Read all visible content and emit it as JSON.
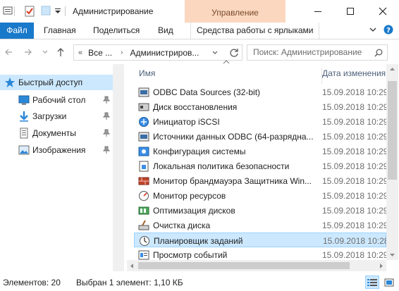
{
  "window": {
    "title": "Администрирование",
    "context_tab": "Управление"
  },
  "ribbon": {
    "tabs": [
      "Файл",
      "Главная",
      "Поделиться",
      "Вид",
      "Средства работы с ярлыками"
    ]
  },
  "address": {
    "segments": [
      "Все ...",
      "Администриров..."
    ],
    "search_placeholder": "Поиск: Администрирование"
  },
  "nav": {
    "items": [
      {
        "label": "Быстрый доступ",
        "icon": "star-icon",
        "selected": true
      },
      {
        "label": "Рабочий стол",
        "icon": "desktop-icon",
        "pinned": true
      },
      {
        "label": "Загрузки",
        "icon": "download-icon",
        "pinned": true
      },
      {
        "label": "Документы",
        "icon": "documents-icon",
        "pinned": true
      },
      {
        "label": "Изображения",
        "icon": "pictures-icon",
        "pinned": true
      }
    ]
  },
  "list": {
    "col_name": "Имя",
    "col_date": "Дата изменения",
    "rows": [
      {
        "name": "ODBC Data Sources (32-bit)",
        "date": "15.09.2018 10:29",
        "icon": "odbc-icon"
      },
      {
        "name": "Диск восстановления",
        "date": "15.09.2018 10:29",
        "icon": "recovery-icon"
      },
      {
        "name": "Инициатор iSCSI",
        "date": "15.09.2018 10:29",
        "icon": "iscsi-icon"
      },
      {
        "name": "Источники данных ODBC (64-разрядна...",
        "date": "15.09.2018 10:29",
        "icon": "odbc-icon"
      },
      {
        "name": "Конфигурация системы",
        "date": "15.09.2018 10:29",
        "icon": "msconfig-icon"
      },
      {
        "name": "Локальная политика безопасности",
        "date": "15.09.2018 10:29",
        "icon": "security-policy-icon"
      },
      {
        "name": "Монитор брандмауэра Защитника Win...",
        "date": "15.09.2018 10:29",
        "icon": "firewall-icon"
      },
      {
        "name": "Монитор ресурсов",
        "date": "15.09.2018 10:29",
        "icon": "resmon-icon"
      },
      {
        "name": "Оптимизация дисков",
        "date": "15.09.2018 10:29",
        "icon": "defrag-icon"
      },
      {
        "name": "Очистка диска",
        "date": "15.09.2018 10:29",
        "icon": "cleanup-icon"
      },
      {
        "name": "Планировщик заданий",
        "date": "15.09.2018 10:28",
        "icon": "task-scheduler-icon",
        "selected": true
      },
      {
        "name": "Просмотр событий",
        "date": "15.09.2018 10:29",
        "icon": "event-viewer-icon"
      }
    ]
  },
  "status": {
    "count": "Элементов: 20",
    "selection": "Выбран 1 элемент: 1,10 КБ"
  },
  "colors": {
    "file_tab": "#1979ca",
    "context_tab_bg": "#fbd7c0",
    "selection_bg": "#cce8ff",
    "selection_border": "#99d1ff"
  }
}
